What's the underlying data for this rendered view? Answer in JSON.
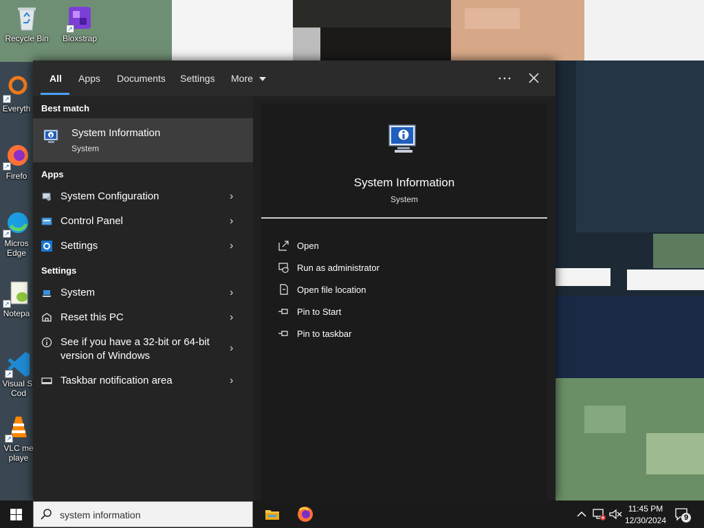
{
  "desktop": {
    "icons": [
      {
        "label": "Recycle Bin",
        "icon": "recycle-bin-icon"
      },
      {
        "label": "Bloxstrap",
        "icon": "bloxstrap-icon"
      },
      {
        "label": "Everyth",
        "icon": "everything-icon"
      },
      {
        "label": "Firefo",
        "icon": "firefox-icon"
      },
      {
        "label": "Micros",
        "label2": "Edge",
        "icon": "edge-icon"
      },
      {
        "label": "Notepa",
        "icon": "notepad-plus-plus-icon"
      },
      {
        "label": "Visual St",
        "label2": "Cod",
        "icon": "vscode-icon"
      },
      {
        "label": "VLC me",
        "label2": "playe",
        "icon": "vlc-icon"
      }
    ]
  },
  "search_panel": {
    "tabs": [
      "All",
      "Apps",
      "Documents",
      "Settings",
      "More"
    ],
    "active_tab": "All",
    "more_button_icon": "ellipsis-icon",
    "close_icon": "close-icon",
    "best_match": {
      "header": "Best match",
      "title": "System Information",
      "subtitle": "System"
    },
    "apps": {
      "header": "Apps",
      "items": [
        "System Configuration",
        "Control Panel",
        "Settings"
      ]
    },
    "settings": {
      "header": "Settings",
      "items": [
        "System",
        "Reset this PC",
        "See if you have a 32-bit or 64-bit",
        "version of Windows",
        "Taskbar notification area"
      ]
    },
    "detail": {
      "title": "System Information",
      "subtitle": "System",
      "actions": [
        "Open",
        "Run as administrator",
        "Open file location",
        "Pin to Start",
        "Pin to taskbar"
      ]
    }
  },
  "taskbar": {
    "search_text": "system information",
    "clock_time": "11:45 PM",
    "clock_date": "12/30/2024",
    "notification_count": "9"
  },
  "colors": {
    "accent": "#4aa3ff",
    "flyout_bg": "#1f1f1f",
    "selected_row": "#3d3d3d",
    "taskbar": "#1a1a1a"
  }
}
